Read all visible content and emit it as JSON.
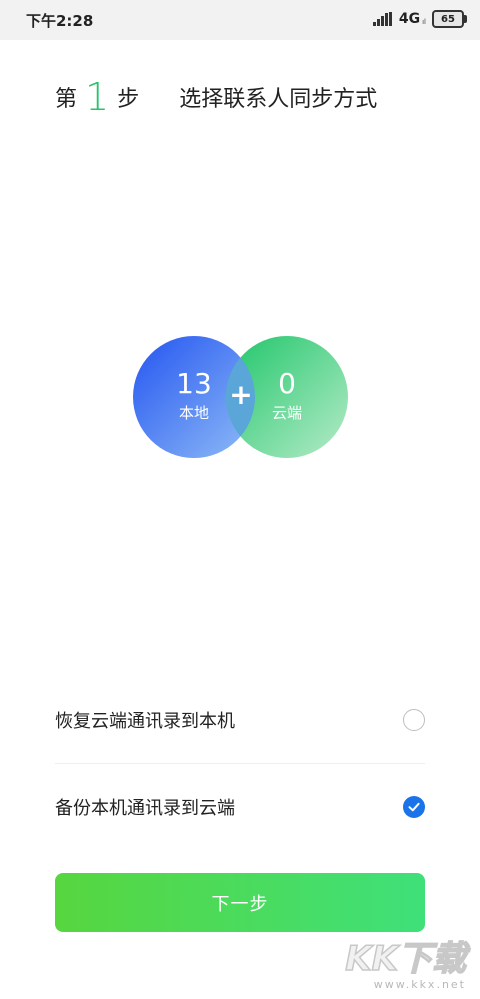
{
  "status_bar": {
    "time": "下午2:28",
    "network": "4G",
    "network_sub": "ıl",
    "battery": "65"
  },
  "header": {
    "step_prefix": "第",
    "step_number": "1",
    "step_suffix": "步",
    "title": "选择联系人同步方式"
  },
  "sync_summary": {
    "local": {
      "count": "13",
      "label": "本地",
      "color": "#2a62f2"
    },
    "cloud": {
      "count": "0",
      "label": "云端",
      "color": "#2cc86f"
    },
    "plus": "+"
  },
  "options": [
    {
      "label": "恢复云端通讯录到本机",
      "selected": false
    },
    {
      "label": "备份本机通讯录到云端",
      "selected": true
    }
  ],
  "next_button": {
    "label": "下一步"
  },
  "watermark": {
    "brand": "KK下载",
    "url": "www.kkx.net"
  }
}
